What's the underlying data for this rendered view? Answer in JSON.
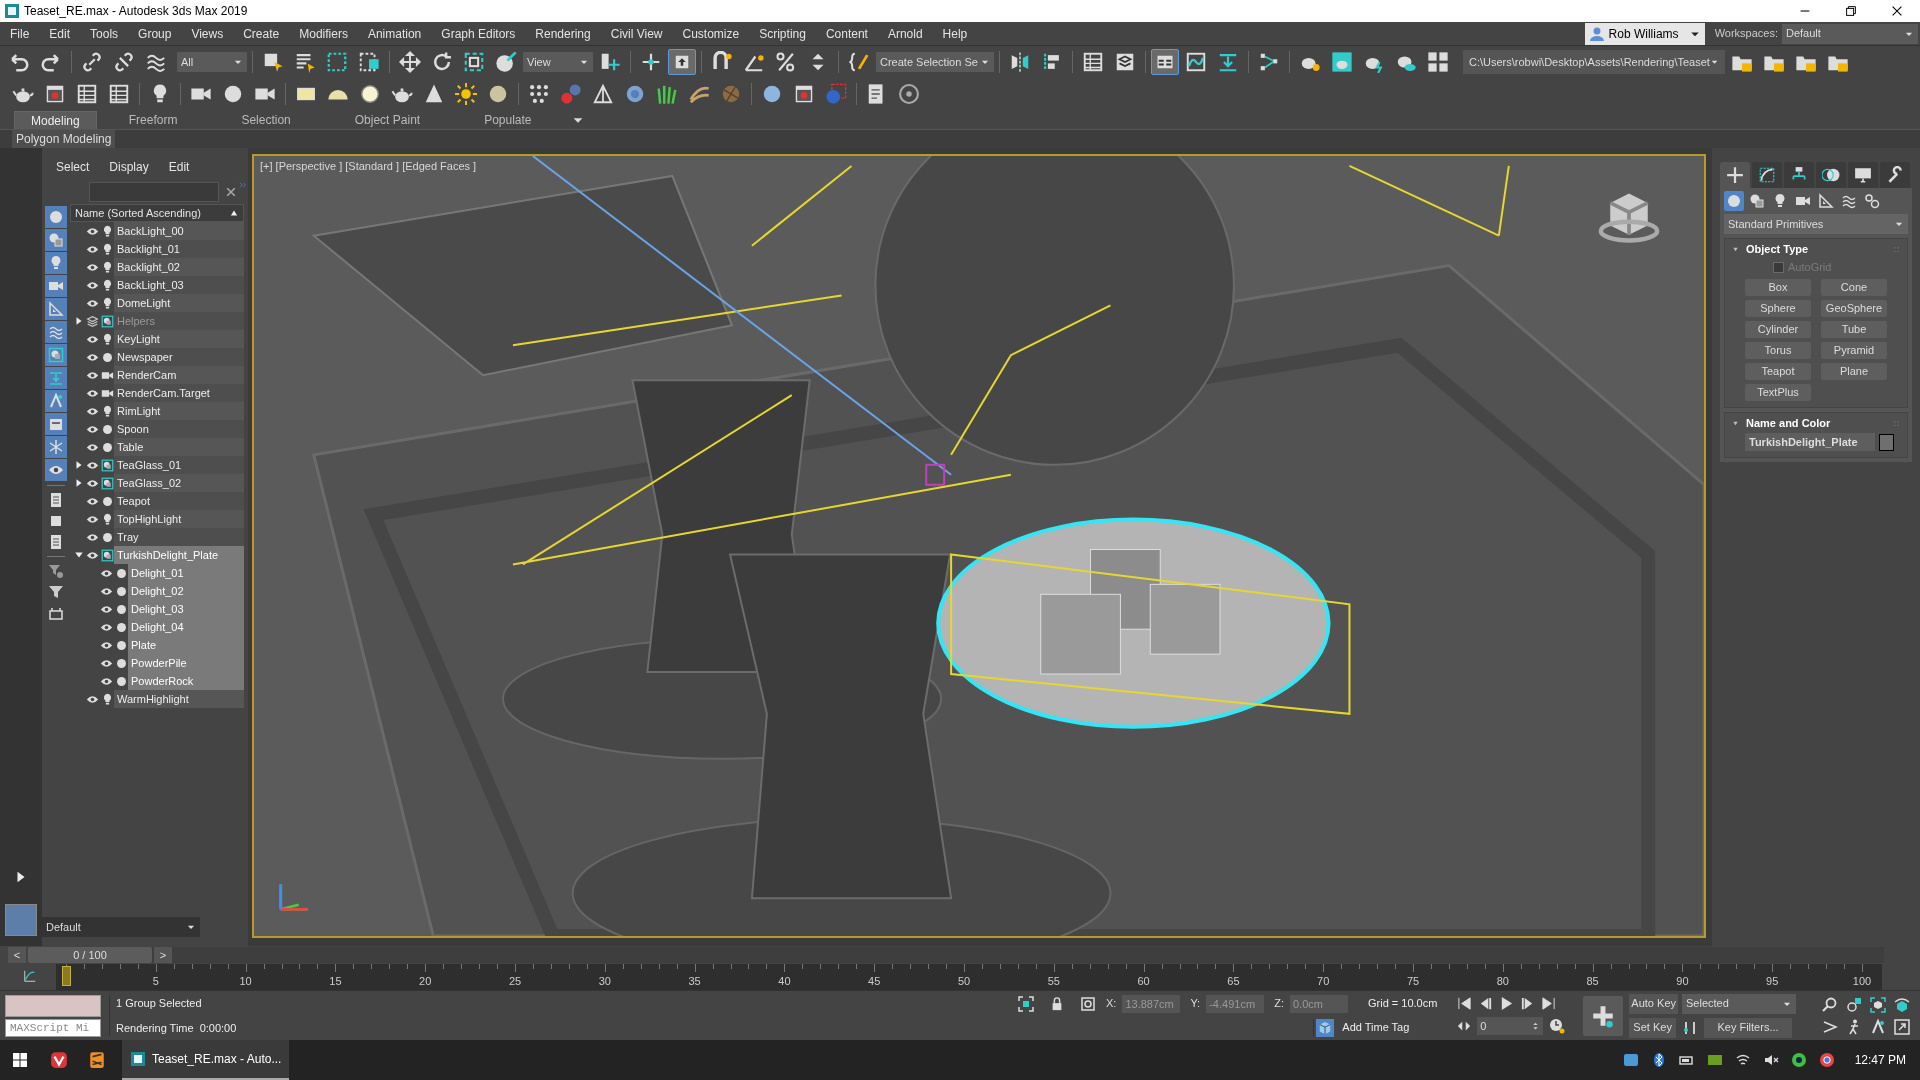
{
  "title_bar": {
    "title": "Teaset_RE.max - Autodesk 3ds Max 2019"
  },
  "menu": [
    "File",
    "Edit",
    "Tools",
    "Group",
    "Views",
    "Create",
    "Modifiers",
    "Animation",
    "Graph Editors",
    "Rendering",
    "Civil View",
    "Customize",
    "Scripting",
    "Content",
    "Arnold",
    "Help"
  ],
  "account": {
    "user": "Rob Williams",
    "workspaces_label": "Workspaces:",
    "workspace": "Default"
  },
  "main_toolbar": {
    "selection_filter": "All",
    "reference_coordinate": "View",
    "named_selection": "Create Selection Se",
    "project_path": "C:\\Users\\robwi\\Desktop\\Assets\\Rendering\\Teaset",
    "keyboard_override_on": true,
    "ribbon_on": true
  },
  "ribbon": {
    "tabs": [
      {
        "label": "Modeling",
        "selected": true
      },
      {
        "label": "Freeform",
        "selected": false
      },
      {
        "label": "Selection",
        "selected": false
      },
      {
        "label": "Object Paint",
        "selected": false
      },
      {
        "label": "Populate",
        "selected": false
      }
    ],
    "panel": "Polygon Modeling"
  },
  "scene_explorer": {
    "menu": [
      "Select",
      "Display",
      "Edit"
    ],
    "filters": [
      {
        "on": true
      },
      {
        "on": true
      },
      {
        "on": true
      },
      {
        "on": true
      },
      {
        "on": true
      },
      {
        "on": true
      },
      {
        "on": true
      },
      {
        "on": true
      },
      {
        "on": true
      },
      {
        "on": true
      },
      {
        "on": true
      },
      {
        "on": true
      }
    ],
    "column": "Name (Sorted Ascending)",
    "items": [
      {
        "name": "BackLight_00",
        "kind": "light",
        "selected": false,
        "dimmed": false
      },
      {
        "name": "Backlight_01",
        "kind": "light",
        "selected": false,
        "dimmed": false
      },
      {
        "name": "Backlight_02",
        "kind": "light",
        "selected": false,
        "dimmed": false
      },
      {
        "name": "BackLight_03",
        "kind": "light",
        "selected": false,
        "dimmed": false
      },
      {
        "name": "DomeLight",
        "kind": "light",
        "selected": false,
        "dimmed": false
      },
      {
        "name": "Helpers",
        "kind": "layer",
        "selected": false,
        "dimmed": true,
        "expanded": false
      },
      {
        "name": "KeyLight",
        "kind": "light",
        "selected": false,
        "dimmed": false
      },
      {
        "name": "Newspaper",
        "kind": "geometry",
        "selected": false,
        "dimmed": false
      },
      {
        "name": "RenderCam",
        "kind": "camera",
        "selected": false,
        "dimmed": false
      },
      {
        "name": "RenderCam.Target",
        "kind": "camera",
        "selected": false,
        "dimmed": false
      },
      {
        "name": "RimLight",
        "kind": "light",
        "selected": false,
        "dimmed": false
      },
      {
        "name": "Spoon",
        "kind": "geometry",
        "selected": false,
        "dimmed": false
      },
      {
        "name": "Table",
        "kind": "geometry",
        "selected": false,
        "dimmed": false
      },
      {
        "name": "TeaGlass_01",
        "kind": "group",
        "selected": false,
        "dimmed": false,
        "expanded": false
      },
      {
        "name": "TeaGlass_02",
        "kind": "group",
        "selected": false,
        "dimmed": false,
        "expanded": false
      },
      {
        "name": "Teapot",
        "kind": "geometry",
        "selected": false,
        "dimmed": false
      },
      {
        "name": "TopHighLight",
        "kind": "light",
        "selected": false,
        "dimmed": false
      },
      {
        "name": "Tray",
        "kind": "geometry",
        "selected": false,
        "dimmed": false
      },
      {
        "name": "TurkishDelight_Plate",
        "kind": "group",
        "selected": true,
        "dimmed": false,
        "expanded": true,
        "children": [
          {
            "name": "Delight_01",
            "kind": "geometry",
            "selected": true,
            "dimmed": false
          },
          {
            "name": "Delight_02",
            "kind": "geometry",
            "selected": true,
            "dimmed": false
          },
          {
            "name": "Delight_03",
            "kind": "geometry",
            "selected": true,
            "dimmed": false
          },
          {
            "name": "Delight_04",
            "kind": "geometry",
            "selected": true,
            "dimmed": false
          },
          {
            "name": "Plate",
            "kind": "geometry",
            "selected": true,
            "dimmed": false
          },
          {
            "name": "PowderPile",
            "kind": "geometry",
            "selected": true,
            "dimmed": false
          },
          {
            "name": "PowderRock",
            "kind": "geometry",
            "selected": true,
            "dimmed": false
          }
        ]
      },
      {
        "name": "WarmHighlight",
        "kind": "light",
        "selected": false,
        "dimmed": false
      }
    ],
    "layer": "Default"
  },
  "viewport": {
    "label": "[+] [Perspective ] [Standard ] [Edged Faces ]"
  },
  "command_panel": {
    "tabs": [
      {
        "selected": true
      },
      {
        "selected": false
      },
      {
        "selected": false
      },
      {
        "selected": false
      },
      {
        "selected": false
      },
      {
        "selected": false
      }
    ],
    "categories": [
      {
        "selected": true
      },
      {
        "selected": false
      },
      {
        "selected": false
      },
      {
        "selected": false
      },
      {
        "selected": false
      },
      {
        "selected": false
      },
      {
        "selected": false
      }
    ],
    "dropdown": "Standard Primitives",
    "object_type": {
      "title": "Object Type",
      "autogrid": {
        "label": "AutoGrid",
        "checked": false,
        "disabled": true
      },
      "buttons": [
        "Box",
        "Cone",
        "Sphere",
        "GeoSphere",
        "Cylinder",
        "Tube",
        "Torus",
        "Pyramid",
        "Teapot",
        "Plane",
        "TextPlus"
      ]
    },
    "name_and_color": {
      "title": "Name and Color",
      "name": "TurkishDelight_Plate",
      "color": "#6f6f6f"
    }
  },
  "timeline": {
    "frame": "0 / 100",
    "level": 0,
    "prev": "<",
    "next": ">",
    "ruler_labels": [
      "5",
      "10",
      "15",
      "20",
      "25",
      "30",
      "35",
      "40",
      "45",
      "50",
      "55",
      "60",
      "65",
      "70",
      "75",
      "80",
      "85",
      "90",
      "95",
      "100"
    ]
  },
  "status": {
    "maxscript": "MAXScript Mi",
    "selection": "1 Group Selected",
    "render_label": "Rendering Time",
    "render_time": "0:00:00",
    "x_label": "X:",
    "x": "13.887cm",
    "y_label": "Y:",
    "y": "-4.491cm",
    "z_label": "Z:",
    "z": "0.0cm",
    "grid": "Grid = 10.0cm",
    "add_time_tag": "Add Time Tag",
    "current_frame": "0",
    "auto_key": "Auto Key",
    "key_mode": "Selected",
    "set_key": "Set Key",
    "key_filters": "Key Filters..."
  },
  "taskbar": {
    "app": "Teaset_RE.max - Auto...",
    "time": "12:47 PM"
  }
}
